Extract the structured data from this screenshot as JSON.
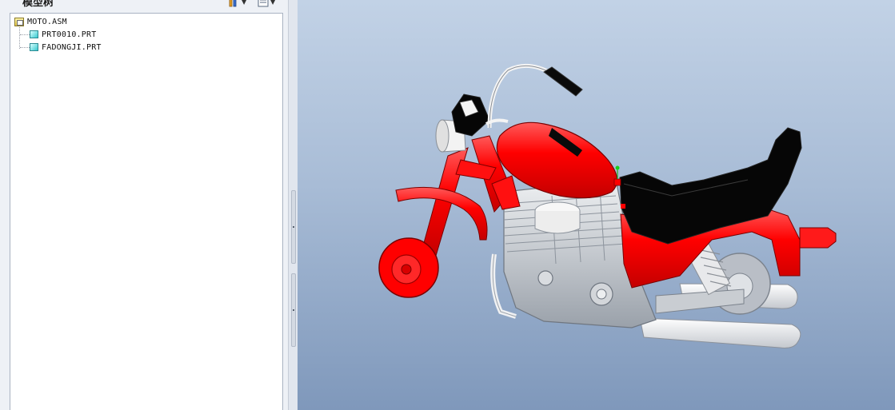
{
  "model_tree": {
    "title": "模型树",
    "show_button_icon": "tree-columns-icon",
    "settings_button_icon": "tree-settings-icon",
    "items": [
      {
        "label": "MOTO.ASM",
        "icon": "assembly-icon",
        "level": 0
      },
      {
        "label": "PRT0010.PRT",
        "icon": "part-icon",
        "level": 1
      },
      {
        "label": "FADONGJI.PRT",
        "icon": "part-icon",
        "level": 1
      }
    ]
  },
  "viewport": {
    "model": "motorcycle-assembly",
    "colors": {
      "frame_red": "#ff0000",
      "seat_black": "#050505",
      "engine_gray": "#c9cdd2",
      "chrome": "#f2f2f2",
      "background_top": "#c2d2e6",
      "background_bottom": "#7f98bb"
    }
  }
}
